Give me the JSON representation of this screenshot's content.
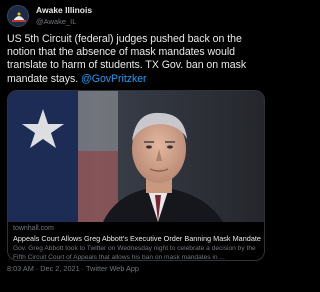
{
  "account": {
    "display_name": "Awake Illinois",
    "handle": "@Awake_IL"
  },
  "tweet": {
    "text_main": "US 5th Circuit (federal) judges pushed back on the notion that the absence of mask mandates would translate to harm of students. TX Gov. ban on mask mandate stays. ",
    "mention": "@GovPritzker"
  },
  "card": {
    "domain": "townhall.com",
    "title": "Appeals Court Allows Greg Abbott's Executive Order Banning Mask Mandates ...",
    "description": "Gov. Greg Abbott took to Twitter on Wednesday night to celebrate a decision by the Fifth Circuit Court of Appeals that allows his ban on mask mandates in ..."
  },
  "footer": {
    "time": "8:03 AM",
    "separator": " · ",
    "date": "Dec 2, 2021",
    "source": "Twitter Web App"
  },
  "colors": {
    "background": "#000000",
    "text": "#e7e9ea",
    "muted": "#71767b",
    "link": "#1d9bf0",
    "border": "#2f3336"
  },
  "icons": {
    "avatar": "awake-illinois-logo-icon"
  }
}
